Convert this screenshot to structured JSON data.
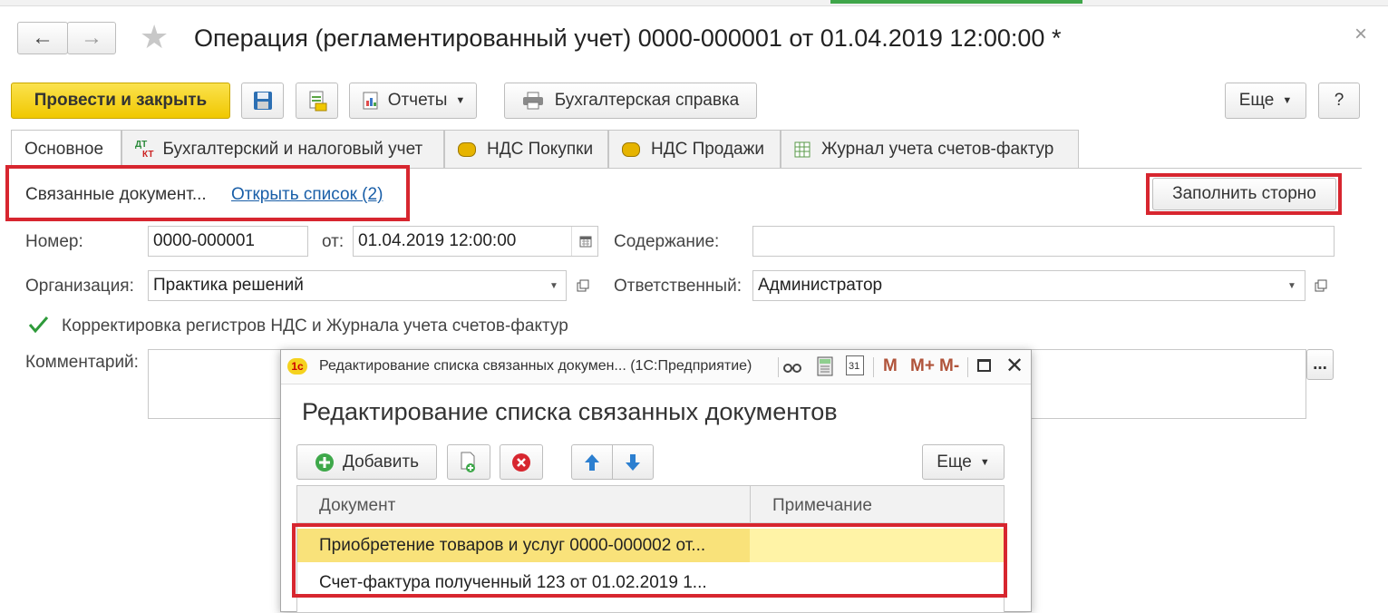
{
  "window": {
    "title": "Операция (регламентированный учет) 0000-000001 от 01.04.2019 12:00:00 *",
    "close": "×"
  },
  "toolbar": {
    "post_close": "Провести и закрыть",
    "reports": "Отчеты",
    "accounting_ref": "Бухгалтерская справка",
    "more": "Еще",
    "help": "?"
  },
  "tabs": [
    {
      "label": "Основное"
    },
    {
      "label": "Бухгалтерский и налоговый учет",
      "icon_top": "ДТ",
      "icon_bottom": "КТ"
    },
    {
      "label": "НДС Покупки"
    },
    {
      "label": "НДС Продажи"
    },
    {
      "label": "Журнал учета счетов-фактур"
    }
  ],
  "linked": {
    "label": "Связанные документ...",
    "link": "Открыть список (2)",
    "fill_storno": "Заполнить сторно"
  },
  "form": {
    "number_label": "Номер:",
    "number_value": "0000-000001",
    "from_label": "от:",
    "date_value": "01.04.2019 12:00:00",
    "content_label": "Содержание:",
    "content_value": "",
    "org_label": "Организация:",
    "org_value": "Практика решений",
    "resp_label": "Ответственный:",
    "resp_value": "Администратор",
    "checkbox_label": "Корректировка регистров НДС и Журнала учета счетов-фактур",
    "checkbox_checked": true,
    "comment_label": "Комментарий:",
    "comment_value": "",
    "ellipsis": "..."
  },
  "dialog": {
    "app_icon": "1с",
    "title": "Редактирование списка связанных докумен... (1С:Предприятие)",
    "m": "M",
    "mplus": "M+",
    "mminus": "M-",
    "cal": "31",
    "heading": "Редактирование списка связанных документов",
    "add": "Добавить",
    "more": "Еще",
    "columns": [
      "Документ",
      "Примечание"
    ],
    "rows": [
      {
        "doc": "Приобретение товаров и услуг 0000-000002 от...",
        "note": ""
      },
      {
        "doc": "Счет-фактура полученный 123 от 01.02.2019 1...",
        "note": ""
      }
    ]
  },
  "colors": {
    "accent_yellow": "#f5d21e",
    "highlight_red": "#d7262f",
    "selected_row": "#f9e27a",
    "link_blue": "#1a5fa8"
  }
}
